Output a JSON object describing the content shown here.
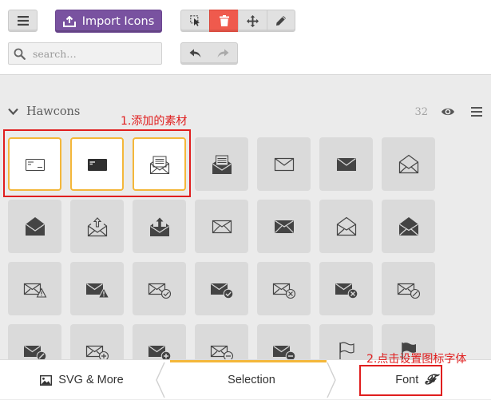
{
  "toolbar": {
    "import_label": "Import Icons",
    "tools": [
      {
        "name": "select-tool",
        "icon": "cursor-select-icon",
        "active": false
      },
      {
        "name": "delete-tool",
        "icon": "trash-icon",
        "active": true
      },
      {
        "name": "move-tool",
        "icon": "move-arrows-icon",
        "active": false
      },
      {
        "name": "edit-tool",
        "icon": "pencil-icon",
        "active": false
      }
    ]
  },
  "search": {
    "placeholder": "search…",
    "value": ""
  },
  "icon_set": {
    "name": "Hawcons",
    "count": "32",
    "rows": [
      [
        "card-front",
        "card-back",
        "envelope-letter",
        "envelope-open-letter-dark",
        "envelope",
        "envelope-filled",
        "envelope-open"
      ],
      [
        "envelope-open-filled",
        "envelope-open-upload",
        "envelope-open-upload-filled",
        "envelope-x",
        "envelope-x-filled",
        "envelope-open-x",
        "envelope-open-x-filled"
      ],
      [
        "envelope-warning",
        "envelope-warning-filled",
        "envelope-check",
        "envelope-check-filled",
        "envelope-cancel",
        "envelope-cancel-filled",
        "envelope-block"
      ],
      [
        "envelope-block-filled",
        "envelope-plus",
        "envelope-plus-filled",
        "envelope-minus",
        "envelope-minus-filled",
        "flag",
        "flag-filled"
      ]
    ],
    "selected": [
      "card-front",
      "card-back",
      "envelope-letter"
    ]
  },
  "annotations": {
    "first": "1.添加的素材",
    "second": "2.点击设置图标字体"
  },
  "bottom_tabs": {
    "svg_more": "SVG & More",
    "selection": "Selection",
    "font": "Font"
  },
  "colors": {
    "accent_purple": "#7952a0",
    "delete_red": "#ef5a4d",
    "selection_yellow": "#f4b73a",
    "annotation_red": "#e01e1e"
  }
}
